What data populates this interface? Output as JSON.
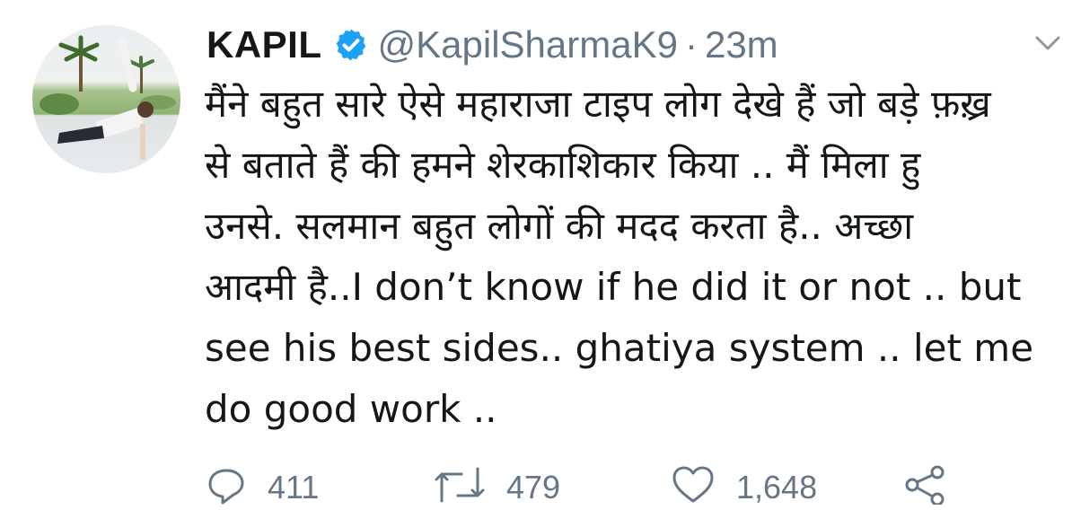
{
  "tweet": {
    "author_name": "KAPIL",
    "handle": "@KapilSharmaK9",
    "separator": "·",
    "time": "23m",
    "text": "मैंने बहुत सारे ऐसे महाराजा टाइप लोग देखे हैं जो बड़े फ़ख़्र\nसे बताते हैं की हमने शेरकाशिकार किया .. मैं मिला हु\nउनसे. सलमान बहुत लोगों की मदद करता है.. अच्छा\nआदमी है..I don’t know if he did it or not .. but\nsee his best sides.. ghatiya system .. let me\ndo good work ..",
    "reply_count": "411",
    "retweet_count": "479",
    "like_count": "1,648"
  },
  "icons": {
    "verified": "verified-badge-icon",
    "more": "chevron-down-icon",
    "reply": "reply-icon",
    "retweet": "retweet-icon",
    "like": "heart-icon",
    "share": "share-icon"
  },
  "colors": {
    "text": "#14171a",
    "secondary": "#657786",
    "verified": "#1da1f2"
  }
}
